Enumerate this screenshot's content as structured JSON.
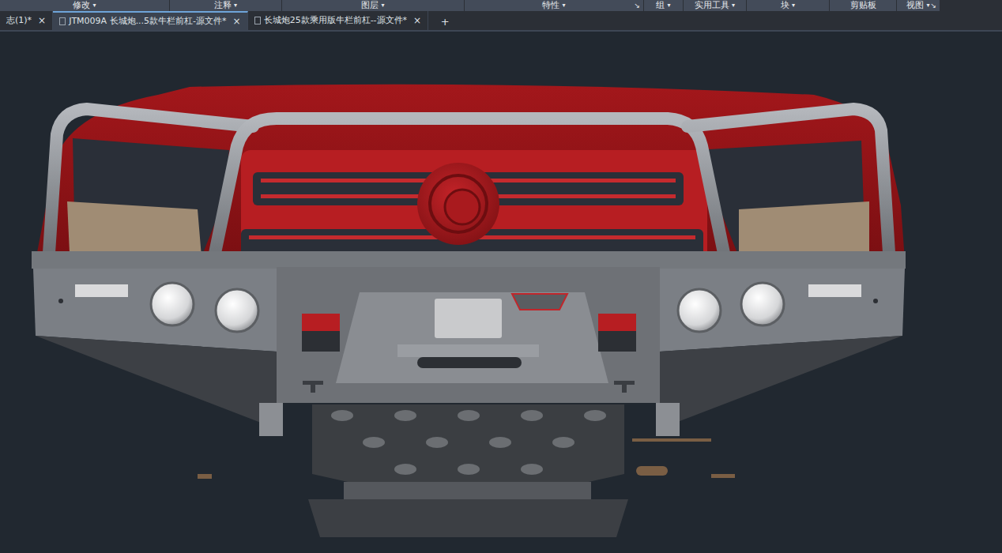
{
  "ribbon": {
    "panels": [
      {
        "label": "修改",
        "arrow": "▾"
      },
      {
        "label": "注释",
        "arrow": "▾"
      },
      {
        "label": "图层",
        "arrow": "▾"
      },
      {
        "label": "特性",
        "arrow": "▾",
        "launcher": "↘"
      },
      {
        "label": "组",
        "arrow": "▾"
      },
      {
        "label": "实用工具",
        "arrow": "▾"
      },
      {
        "label": "块",
        "arrow": "▾"
      },
      {
        "label": "剪贴板"
      },
      {
        "label": "视图",
        "arrow": "▾",
        "launcher": "↘"
      }
    ]
  },
  "tabs": [
    {
      "label": "志(1)*",
      "close": "×",
      "selected": false
    },
    {
      "label": "JTM009A 长城炮...5款牛栏前杠-源文件*",
      "close": "×",
      "selected": true
    },
    {
      "label": "长城炮25款乘用版牛栏前杠--源文件*",
      "close": "×",
      "selected": false
    }
  ],
  "new_tab": "+"
}
